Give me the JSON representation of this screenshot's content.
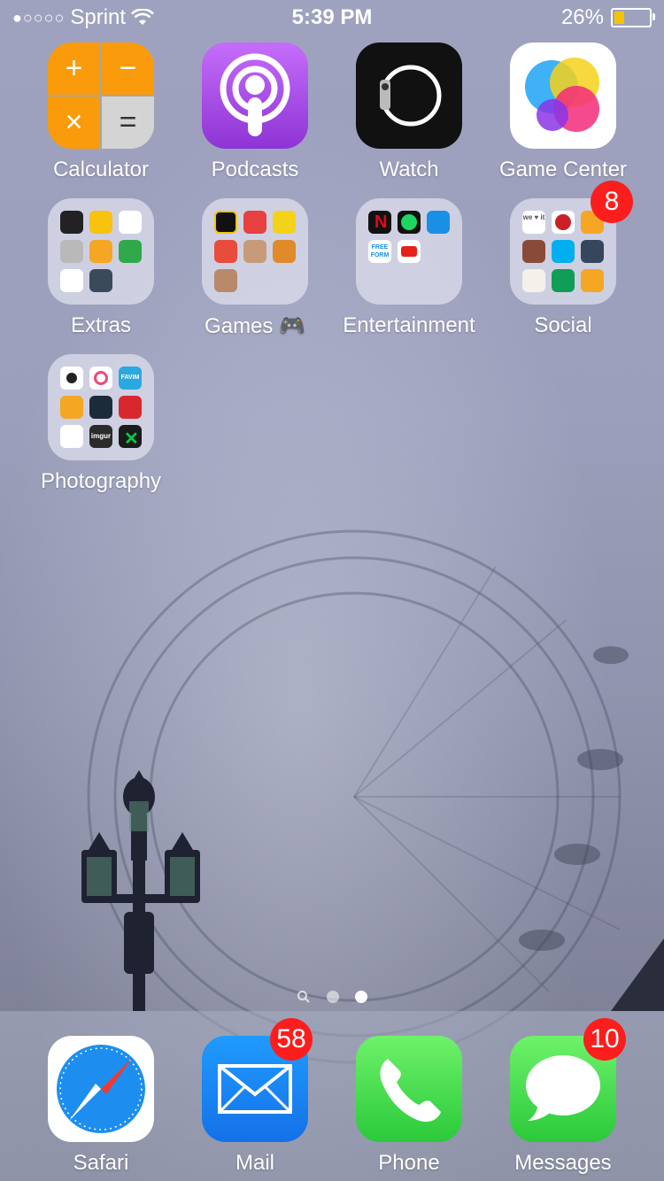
{
  "status": {
    "signal_dots": "●○○○○",
    "carrier": "Sprint",
    "time": "5:39 PM",
    "battery_percent": "26%",
    "battery_level": 0.26
  },
  "apps": [
    {
      "label": "Calculator"
    },
    {
      "label": "Podcasts"
    },
    {
      "label": "Watch"
    },
    {
      "label": "Game Center"
    }
  ],
  "folders": [
    {
      "label": "Extras",
      "badge": ""
    },
    {
      "label": "Games 🎮",
      "badge": ""
    },
    {
      "label": "Entertainment",
      "badge": ""
    },
    {
      "label": "Social",
      "badge": "8"
    },
    {
      "label": "Photography",
      "badge": ""
    }
  ],
  "calculator_glyphs": [
    "+",
    "−",
    "×",
    "="
  ],
  "mini_icons": {
    "entertainment_freeform": "FREE FORM",
    "photography_favim": "FAVIM",
    "photography_imgur": "imgur",
    "social_weheartit": "we ♥ it"
  },
  "page_indicator": {
    "count": 2,
    "active": 2
  },
  "dock": [
    {
      "label": "Safari",
      "badge": ""
    },
    {
      "label": "Mail",
      "badge": "58"
    },
    {
      "label": "Phone",
      "badge": ""
    },
    {
      "label": "Messages",
      "badge": "10"
    }
  ],
  "colors": {
    "badge": "#fc1d1d",
    "battery": "#f5c400"
  }
}
